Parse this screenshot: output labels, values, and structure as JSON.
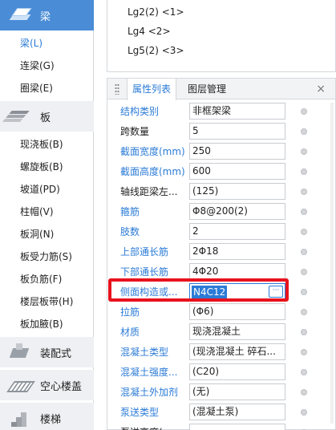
{
  "nav": {
    "beam": {
      "label": "梁",
      "icon": "beam-icon"
    },
    "beam_items": [
      "梁(L)",
      "连梁(G)",
      "圈梁(E)"
    ],
    "slab": {
      "label": "板",
      "icon": "slab-icon"
    },
    "slab_items": [
      "现浇板(B)",
      "螺旋板(B)",
      "坡道(PD)",
      "柱帽(V)",
      "板洞(N)",
      "板受力筋(S)",
      "板负筋(F)",
      "楼层板带(H)",
      "板加腋(B)"
    ],
    "prefab": {
      "label": "装配式",
      "icon": "prefab-icon"
    },
    "hollow": {
      "label": "空心楼盖",
      "icon": "hollow-slab-icon"
    },
    "stair": {
      "label": "楼梯",
      "icon": "stair-icon"
    }
  },
  "components": [
    "Lg2(2) <1>",
    "Lg4 <2>",
    "Lg5(2) <3>"
  ],
  "props": {
    "tab_active": "属性列表",
    "tab_other": "图层管理",
    "close": "×",
    "rows": [
      {
        "name": "结构类别",
        "value": "非框架梁",
        "blue": true
      },
      {
        "name": "跨数量",
        "value": "5",
        "blue": false
      },
      {
        "name": "截面宽度(mm)",
        "value": "250",
        "blue": true
      },
      {
        "name": "截面高度(mm)",
        "value": "600",
        "blue": true
      },
      {
        "name": "轴线距梁左...",
        "value": "(125)",
        "blue": false
      },
      {
        "name": "箍筋",
        "value": "Φ8@200(2)",
        "blue": true
      },
      {
        "name": "肢数",
        "value": "2",
        "blue": true
      },
      {
        "name": "上部通长筋",
        "value": "2Φ18",
        "blue": true
      },
      {
        "name": "下部通长筋",
        "value": "4Φ20",
        "blue": true
      },
      {
        "name": "侧面构造或...",
        "value": "N4C12",
        "blue": true
      },
      {
        "name": "拉筋",
        "value": "(Φ6)",
        "blue": true
      },
      {
        "name": "材质",
        "value": "现浇混凝土",
        "blue": true
      },
      {
        "name": "混凝土类型",
        "value": "(现浇混凝土 碎石...",
        "blue": true
      },
      {
        "name": "混凝土强度...",
        "value": "(C20)",
        "blue": true
      },
      {
        "name": "混凝土外加剂",
        "value": "(无)",
        "blue": true
      },
      {
        "name": "泵送类型",
        "value": "(混凝土泵)",
        "blue": true
      },
      {
        "name": "泵送高度(...",
        "value": "",
        "blue": false
      }
    ],
    "more_label": "···"
  }
}
